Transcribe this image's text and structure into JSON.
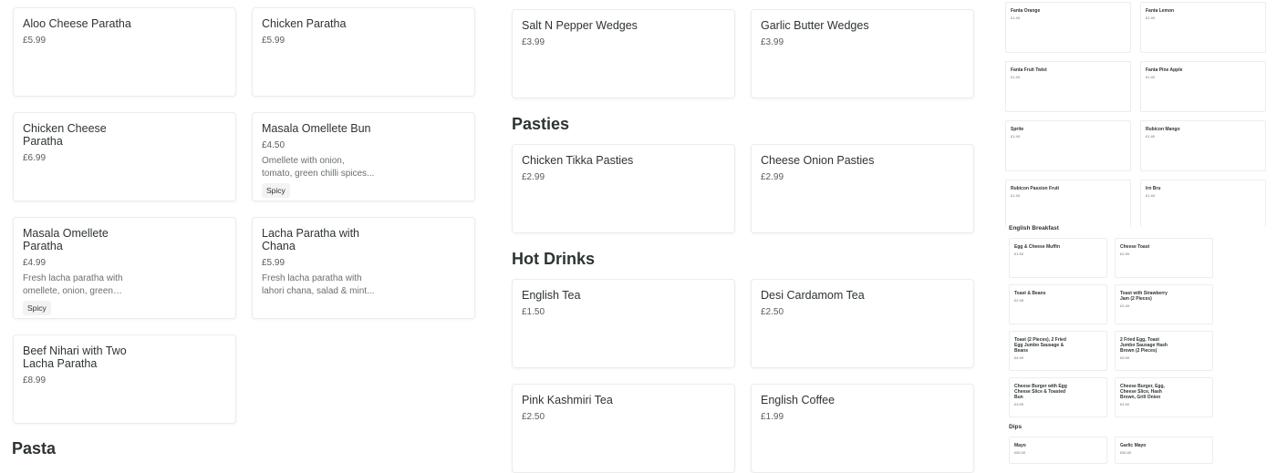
{
  "col1": {
    "items": [
      {
        "name": "Aloo Cheese Paratha",
        "price": "£5.99"
      },
      {
        "name": "Chicken Paratha",
        "price": "£5.99"
      },
      {
        "name": "Chicken Cheese Paratha",
        "price": "£6.99"
      },
      {
        "name": "Masala Omellete Bun",
        "price": "£4.50",
        "desc": "Omellete with onion, tomato, green chilli spices...",
        "tag": "Spicy"
      },
      {
        "name": "Masala Omellete Paratha",
        "price": "£4.99",
        "desc": "Fresh lacha paratha with omellete, onion, green chill...",
        "tag": "Spicy"
      },
      {
        "name": "Lacha Paratha with Chana",
        "price": "£5.99",
        "desc": "Fresh lacha paratha with lahori chana, salad & mint..."
      },
      {
        "name": "Beef Nihari with Two Lacha Paratha",
        "price": "£8.99"
      }
    ],
    "next_heading": "Pasta"
  },
  "col2": {
    "wedges": [
      {
        "name": "Salt N Pepper Wedges",
        "price": "£3.99"
      },
      {
        "name": "Garlic Butter Wedges",
        "price": "£3.99"
      }
    ],
    "pasties_heading": "Pasties",
    "pasties": [
      {
        "name": "Chicken Tikka Pasties",
        "price": "£2.99"
      },
      {
        "name": "Cheese Onion Pasties",
        "price": "£2.99"
      }
    ],
    "hot_drinks_heading": "Hot Drinks",
    "hot_drinks": [
      {
        "name": "English Tea",
        "price": "£1.50"
      },
      {
        "name": "Desi Cardamom Tea",
        "price": "£2.50"
      },
      {
        "name": "Pink Kashmiri Tea",
        "price": "£2.50"
      },
      {
        "name": "English Coffee",
        "price": "£1.99"
      }
    ]
  },
  "col3": {
    "drinks": [
      {
        "name": "Fanta Orange",
        "price": "£1.40"
      },
      {
        "name": "Fanta Lemon",
        "price": "£1.40"
      },
      {
        "name": "Fanta Fruit Twist",
        "price": "£1.40"
      },
      {
        "name": "Fanta Pine Apple",
        "price": "£1.40"
      },
      {
        "name": "Sprite",
        "price": "£1.40"
      },
      {
        "name": "Rubicon Mango",
        "price": "£1.40"
      },
      {
        "name": "Rubicon Passion Fruit",
        "price": "£1.40"
      },
      {
        "name": "Irn Bru",
        "price": "£1.40"
      }
    ]
  },
  "col4": {
    "breakfast_heading": "English Breakfast",
    "breakfast": [
      {
        "name": "Egg & Cheese Muffin",
        "price": "£1.50"
      },
      {
        "name": "Cheese Toast",
        "price": "£2.99"
      },
      {
        "name": "Toast & Beans",
        "price": "£2.95"
      },
      {
        "name": "Toast with Strawberry Jam (2 Pieces)",
        "price": "£2.49"
      },
      {
        "name": "Toast (2 Pieces), 2 Fried Egg Jumbo Sausage & Beans",
        "price": "£4.99"
      },
      {
        "name": "2 Fried Egg, Toast Jumbo Sausage Hash Brown (2 Pieces)",
        "price": "£5.99"
      },
      {
        "name": "Cheese Burger with Egg Cheese Slice & Toasted Bun",
        "price": "£3.99"
      },
      {
        "name": "Cheese Burger, Egg, Cheese Slice, Hash Brown, Grill Onion with...",
        "price": "£4.50"
      }
    ],
    "dips_heading": "Dips",
    "dips": [
      {
        "name": "Mayo",
        "price": "£50.00"
      },
      {
        "name": "Garlic Mayo",
        "price": "£50.00"
      }
    ]
  }
}
